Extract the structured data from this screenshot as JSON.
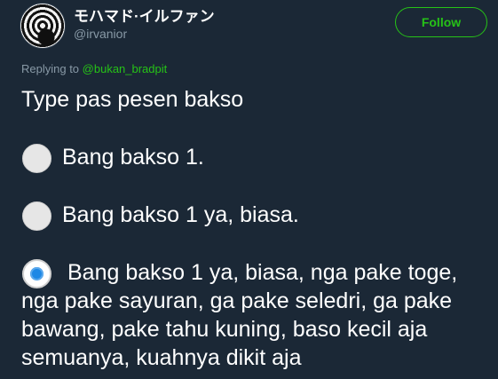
{
  "tweet": {
    "author": {
      "display_name": "モハマド·イルファン",
      "handle": "@irvanior"
    },
    "follow_label": "Follow",
    "replying_prefix": "Replying to ",
    "replying_to": "@bukan_bradpit",
    "intro": "Type pas pesen bakso",
    "options": [
      {
        "label": "Bang bakso 1.",
        "selected": false
      },
      {
        "label": "Bang bakso 1 ya, biasa.",
        "selected": false
      },
      {
        "label": "Bang bakso 1 ya, biasa, nga pake toge, nga pake sayuran, ga pake seledri, ga pake bawang, pake tahu kuning, baso kecil aja semuanya, kuahnya dikit aja",
        "selected": true
      }
    ]
  },
  "colors": {
    "background": "#1b2836",
    "accent": "#26c217",
    "muted": "#8899a6",
    "radio_selected": "#1e88e5"
  }
}
